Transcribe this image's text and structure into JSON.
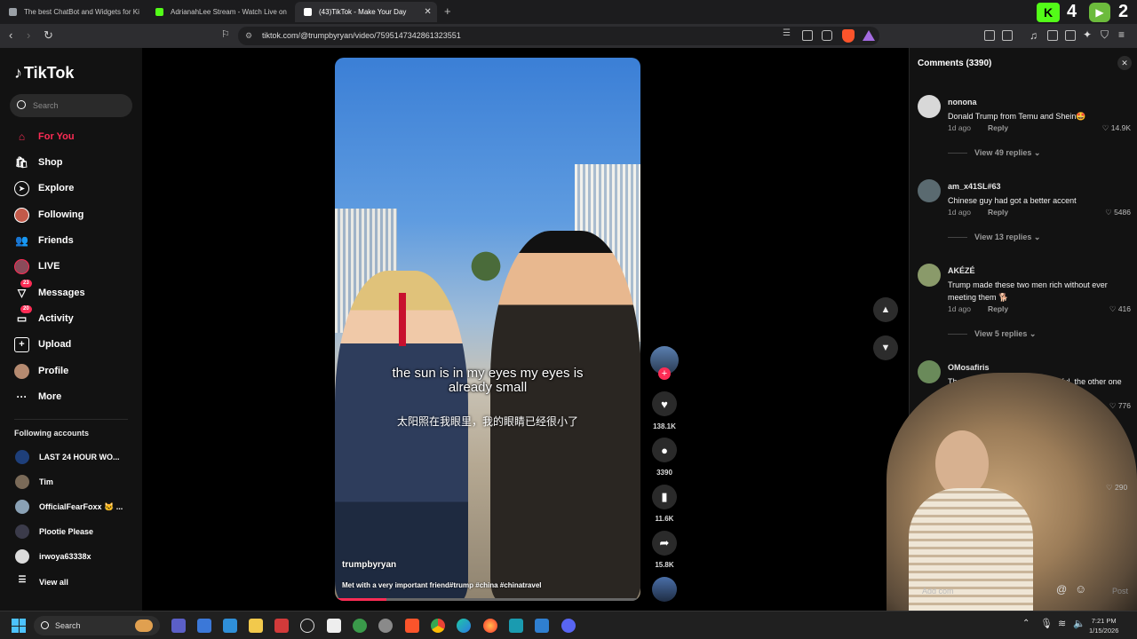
{
  "browser": {
    "tabs": [
      {
        "title": "The best ChatBot and Widgets for Ki",
        "active": false
      },
      {
        "title": "AdrianahLee Stream - Watch Live on",
        "active": false
      },
      {
        "title": "(43)TikTok - Make Your Day",
        "active": true
      }
    ],
    "url": "tiktok.com/@trumpbyryan/video/7595147342861323551",
    "overlay_kick_count": "4",
    "overlay_rumble_count": "2"
  },
  "sidebar": {
    "logo": "TikTok",
    "search_placeholder": "Search",
    "nav": [
      {
        "label": "For You",
        "icon": "home-icon",
        "active": true
      },
      {
        "label": "Shop",
        "icon": "shop-icon"
      },
      {
        "label": "Explore",
        "icon": "compass-icon"
      },
      {
        "label": "Following",
        "icon": "following-icon"
      },
      {
        "label": "Friends",
        "icon": "friends-icon"
      },
      {
        "label": "LIVE",
        "icon": "live-icon"
      },
      {
        "label": "Messages",
        "icon": "messages-icon",
        "badge": "23"
      },
      {
        "label": "Activity",
        "icon": "activity-icon",
        "badge": "20"
      },
      {
        "label": "Upload",
        "icon": "upload-icon"
      },
      {
        "label": "Profile",
        "icon": "profile-icon"
      },
      {
        "label": "More",
        "icon": "more-icon"
      }
    ],
    "following_title": "Following accounts",
    "accounts": [
      "LAST 24 HOUR WO...",
      "Tim",
      "OfficialFearFoxx 🐱 ...",
      "Plootie Please",
      "irwoya63338x"
    ],
    "view_all": "View all"
  },
  "video": {
    "caption_en_line1": "the sun is in my eyes my eyes is",
    "caption_en_line2": "already small",
    "caption_zh": "太阳照在我眼里，我的眼睛已经很小了",
    "username": "trumpbyryan",
    "description": "Met with a very important friend#trump #china #chinatravel",
    "progress": 0.17
  },
  "actions": {
    "likes": "138.1K",
    "comments": "3390",
    "saves": "11.6K",
    "shares": "15.8K"
  },
  "comments": {
    "title": "Comments (3390)",
    "reply_label": "Reply",
    "items": [
      {
        "user": "nonona",
        "text": "Donald Trump from Temu and Shein🤩",
        "time": "1d ago",
        "likes": "14.9K",
        "replies": "View 49 replies"
      },
      {
        "user": "am_x41SL#63",
        "text": "Chinese guy had got a better accent",
        "time": "1d ago",
        "likes": "5486",
        "replies": "View 13 replies"
      },
      {
        "user": "AKÉZÉ",
        "text": "Trump made these two men rich without ever meeting them 🐕",
        "time": "1d ago",
        "likes": "416",
        "replies": "View 5 replies"
      },
      {
        "user": "OMosafiris",
        "text": "The Chinese trump very respectful, the other one rude",
        "time": "",
        "likes": "776",
        "replies": ""
      }
    ],
    "hidden_likes": "290",
    "add_placeholder": "Add com",
    "post_label": "Post"
  },
  "taskbar": {
    "search": "Search",
    "time": "7:21 PM",
    "date": "1/15/2026"
  },
  "colors": {
    "accent": "#fe2c55",
    "background": "#121212"
  }
}
